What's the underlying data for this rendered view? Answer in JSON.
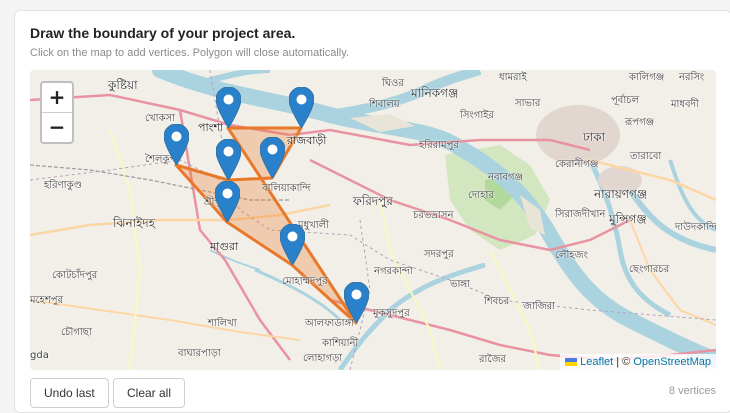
{
  "header": {
    "title": "Draw the boundary of your project area.",
    "instructions": "Click on the map to add vertices. Polygon will close automatically."
  },
  "map": {
    "zoom_in": "+",
    "zoom_out": "−",
    "attribution": {
      "leaflet": "Leaflet",
      "separator": "| ©",
      "osm": "OpenStreetMap"
    },
    "polygon_color": "#e8792b",
    "places": [
      {
        "label": "কুষ্টিয়া",
        "cls": "big"
      },
      {
        "label": "খোকসা",
        "cls": ""
      },
      {
        "label": "পাংশা",
        "cls": "city"
      },
      {
        "label": "রাজবাড়ী",
        "cls": "city"
      },
      {
        "label": "শৈলকুপা",
        "cls": ""
      },
      {
        "label": "হরিণাকুণ্ড",
        "cls": ""
      },
      {
        "label": "বালিয়াকান্দি",
        "cls": ""
      },
      {
        "label": "শ্রীপুর",
        "cls": ""
      },
      {
        "label": "ঝিনাইদহ",
        "cls": "big"
      },
      {
        "label": "মধুখালী",
        "cls": ""
      },
      {
        "label": "মাগুরা",
        "cls": "city"
      },
      {
        "label": "কোটচাঁদপুর",
        "cls": ""
      },
      {
        "label": "মহেশপুর",
        "cls": ""
      },
      {
        "label": "চৌগাছা",
        "cls": ""
      },
      {
        "label": "শালিখা",
        "cls": ""
      },
      {
        "label": "বাঘারপাড়া",
        "cls": ""
      },
      {
        "label": "মোহাম্মদপুর",
        "cls": ""
      },
      {
        "label": "আলফাডাঙ্গা",
        "cls": ""
      },
      {
        "label": "কাশিয়ানী",
        "cls": ""
      },
      {
        "label": "লোহাগড়া",
        "cls": ""
      },
      {
        "label": "মুকসুদপুর",
        "cls": ""
      },
      {
        "label": "নগরকান্দা",
        "cls": ""
      },
      {
        "label": "ফরিদপুর",
        "cls": "big"
      },
      {
        "label": "চরভদ্রাসন",
        "cls": ""
      },
      {
        "label": "সদরপুর",
        "cls": ""
      },
      {
        "label": "ভাঙ্গা",
        "cls": ""
      },
      {
        "label": "শিবচর",
        "cls": ""
      },
      {
        "label": "জাজিরা",
        "cls": ""
      },
      {
        "label": "রাজৈর",
        "cls": ""
      },
      {
        "label": "দোহার",
        "cls": ""
      },
      {
        "label": "নবাবগঞ্জ",
        "cls": ""
      },
      {
        "label": "হরিরামপুর",
        "cls": ""
      },
      {
        "label": "শিবালয়",
        "cls": ""
      },
      {
        "label": "ঘিওর",
        "cls": ""
      },
      {
        "label": "মানিকগঞ্জ",
        "cls": "big"
      },
      {
        "label": "সিংগাইর",
        "cls": ""
      },
      {
        "label": "সাভার",
        "cls": ""
      },
      {
        "label": "ধামরাই",
        "cls": ""
      },
      {
        "label": "ঢাকা",
        "cls": "big"
      },
      {
        "label": "কেরানীগঞ্জ",
        "cls": ""
      },
      {
        "label": "নারায়ণগঞ্জ",
        "cls": "big"
      },
      {
        "label": "সিরাজদীখান",
        "cls": ""
      },
      {
        "label": "মুন্সিগঞ্জ",
        "cls": "big"
      },
      {
        "label": "লৌহজং",
        "cls": ""
      },
      {
        "label": "ছেংগারচর",
        "cls": ""
      },
      {
        "label": "তারাবো",
        "cls": ""
      },
      {
        "label": "পূর্বাচল",
        "cls": ""
      },
      {
        "label": "কালিগঞ্জ",
        "cls": ""
      },
      {
        "label": "নরসিং",
        "cls": ""
      },
      {
        "label": "মাধবদী",
        "cls": ""
      },
      {
        "label": "দাউদকান্দি",
        "cls": ""
      },
      {
        "label": "রূপগঞ্জ",
        "cls": ""
      },
      {
        "label": "gda",
        "cls": ""
      }
    ]
  },
  "footer": {
    "undo_label": "Undo last",
    "clear_label": "Clear all",
    "vertex_count": "8 vertices"
  },
  "colors": {
    "accent": "#2a81cb",
    "polygon": "#e8792b",
    "link": "#0078a8"
  }
}
